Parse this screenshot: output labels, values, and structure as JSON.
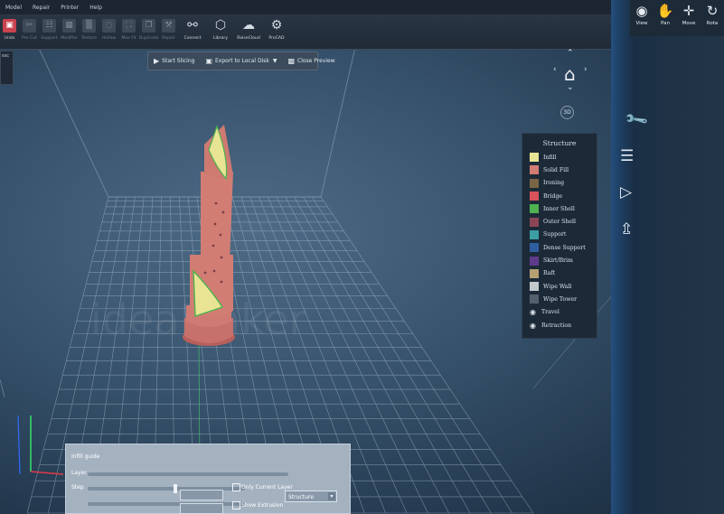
{
  "menubar": {
    "items": [
      "Model",
      "Repair",
      "Printer",
      "Help"
    ]
  },
  "toolbar": {
    "buttons": [
      {
        "label": "Undo",
        "icon": "scale-icon",
        "active": true
      },
      {
        "label": "Pre-Cut",
        "icon": "cut-icon"
      },
      {
        "label": "Support",
        "icon": "support-icon"
      },
      {
        "label": "Modifier",
        "icon": "modifier-icon"
      },
      {
        "label": "Texture",
        "icon": "texture-icon"
      },
      {
        "label": "Hollow",
        "icon": "hollow-icon"
      },
      {
        "label": "Max Fit",
        "icon": "max-fit-icon"
      },
      {
        "label": "Duplicate",
        "icon": "duplicate-icon"
      },
      {
        "label": "Repair",
        "icon": "repair-icon"
      },
      {
        "label": "Connect",
        "icon": "connect-icon"
      },
      {
        "label": "Library",
        "icon": "library-icon"
      },
      {
        "label": "RaiseCloud",
        "icon": "cloud-icon"
      },
      {
        "label": "ProCAD",
        "icon": "procad-icon"
      }
    ]
  },
  "left_stub": {
    "label": "ssc"
  },
  "preview_bar": {
    "start_slicing": "Start Slicing",
    "export": "Export to Local Disk",
    "close_preview": "Close Preview"
  },
  "nav": {
    "view_3d": "3D"
  },
  "legend": {
    "title": "Structure",
    "items": [
      {
        "label": "Infill",
        "color": "#e8e493",
        "kind": "swatch"
      },
      {
        "label": "Solid Fill",
        "color": "#d27d74",
        "kind": "swatch"
      },
      {
        "label": "Ironing",
        "color": "#7a6544",
        "kind": "swatch"
      },
      {
        "label": "Bridge",
        "color": "#d8525b",
        "kind": "swatch"
      },
      {
        "label": "Inner Shell",
        "color": "#4db24f",
        "kind": "swatch"
      },
      {
        "label": "Outer Shell",
        "color": "#8c4556",
        "kind": "swatch"
      },
      {
        "label": "Support",
        "color": "#3b9fa4",
        "kind": "swatch"
      },
      {
        "label": "Dense Support",
        "color": "#2f5ea0",
        "kind": "swatch"
      },
      {
        "label": "Skirt/Brim",
        "color": "#5f3a8a",
        "kind": "swatch"
      },
      {
        "label": "Raft",
        "color": "#b6a174",
        "kind": "swatch"
      },
      {
        "label": "Wipe Wall",
        "color": "#c3c8cb",
        "kind": "swatch"
      },
      {
        "label": "Wipe Tower",
        "color": "#54606c",
        "kind": "swatch"
      },
      {
        "label": "Travel",
        "kind": "eye"
      },
      {
        "label": "Retraction",
        "kind": "eye"
      }
    ]
  },
  "right_toolbar": [
    {
      "label": "View",
      "icon": "eye-icon"
    },
    {
      "label": "Pan",
      "icon": "hand-icon"
    },
    {
      "label": "Move",
      "icon": "move-icon"
    },
    {
      "label": "Rota",
      "icon": "rotate-icon"
    }
  ],
  "layer_panel": {
    "title": "Infill guide",
    "only_current_layer": "Only Current Layer",
    "show_extrusion": "Show Extrusion",
    "view_mode": "Structure"
  },
  "watermark": "ideaMaker"
}
